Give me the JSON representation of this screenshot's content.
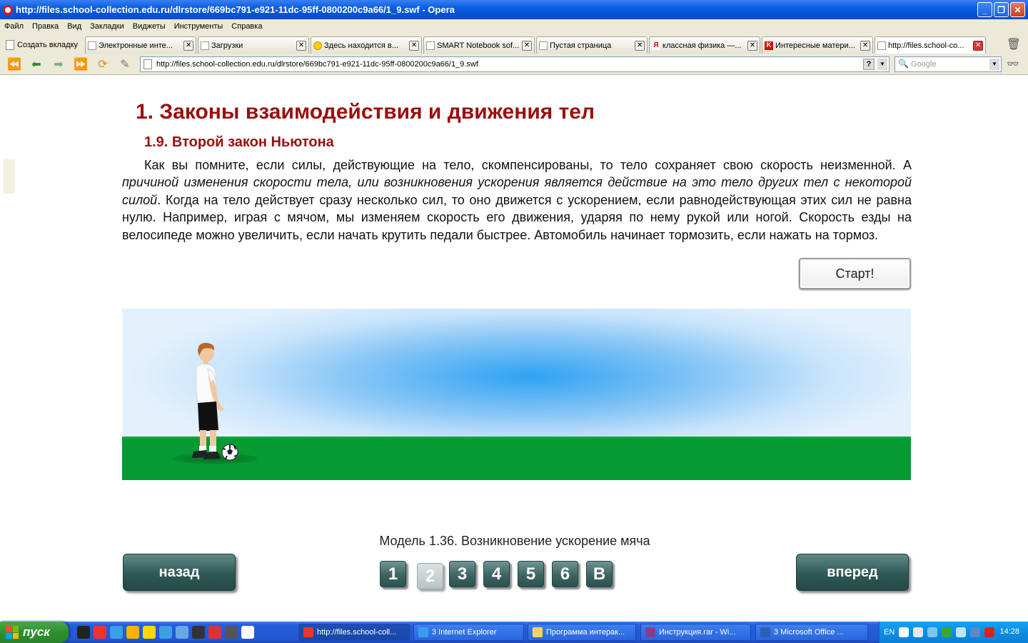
{
  "window": {
    "title": "http://files.school-collection.edu.ru/dlrstore/669bc791-e921-11dc-95ff-0800200c9a66/1_9.swf - Opera"
  },
  "menu": [
    "Файл",
    "Правка",
    "Вид",
    "Закладки",
    "Виджеты",
    "Инструменты",
    "Справка"
  ],
  "new_tab_label": "Создать вкладку",
  "tabs": [
    {
      "label": "Электронные инте...",
      "active": false
    },
    {
      "label": "Загрузки",
      "active": false
    },
    {
      "label": "Здесь находится в...",
      "active": false
    },
    {
      "label": "SMART Notebook sof...",
      "active": false
    },
    {
      "label": "Пустая страница",
      "active": false
    },
    {
      "label": "классная физика —...",
      "active": false
    },
    {
      "label": "Интересные матери...",
      "active": false
    },
    {
      "label": "http://files.school-co...",
      "active": true
    }
  ],
  "address": {
    "url": "http://files.school-collection.edu.ru/dlrstore/669bc791-e921-11dc-95ff-0800200c9a66/1_9.swf",
    "search_placeholder": "Google"
  },
  "page": {
    "heading": "1. Законы взаимодействия и движения тел",
    "subheading": "1.9. Второй закон Ньютона",
    "para_part1": "Как вы помните, если силы, действующие на тело, скомпенсированы, то тело сохраняет свою скорость неизменной. А ",
    "para_italic": "причиной изменения скорости тела, или возникновения ускорения является действие на это тело других тел с некоторой силой",
    "para_part2": ". Когда на тело действует сразу несколько сил, то оно движется с ускорением, если равнодействующая этих сил не равна нулю. Например, играя с мячом, мы изменяем скорость его движения, ударяя по нему рукой или ногой. Скорость езды на велосипеде можно увеличить, если начать крутить педали быстрее. Автомобиль начинает тормозить, если нажать на тормоз.",
    "start_button": "Старт!",
    "caption": "Модель 1.36. Возникновение ускорение мяча",
    "back_button": "назад",
    "forward_button": "вперед",
    "pages": [
      "1",
      "2",
      "3",
      "4",
      "5",
      "6",
      "В"
    ],
    "active_page": "2"
  },
  "taskbar": {
    "start_label": "пуск",
    "items": [
      {
        "label": "http://files.school-coll...",
        "active": true
      },
      {
        "label": "3 Internet Explorer",
        "active": false
      },
      {
        "label": "Программа интерак...",
        "active": false
      },
      {
        "label": "Инструкция.rar - Wi...",
        "active": false
      },
      {
        "label": "3 Microsoft Office ...",
        "active": false
      }
    ],
    "lang": "EN",
    "time": "14:28"
  }
}
